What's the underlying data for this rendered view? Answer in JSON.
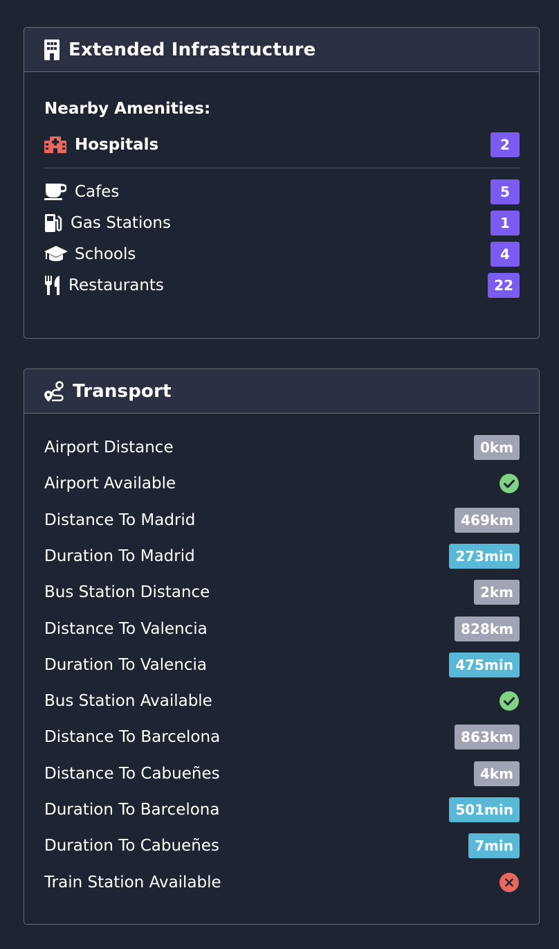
{
  "infrastructure": {
    "title": "Extended Infrastructure",
    "header_icon": "building-icon",
    "section_label": "Nearby Amenities:",
    "highlight": {
      "label": "Hospitals",
      "count": "2",
      "icon": "hospital-icon",
      "icon_color": "#e8685e"
    },
    "items": [
      {
        "label": "Cafes",
        "count": "5",
        "icon": "coffee-cup-icon"
      },
      {
        "label": "Gas Stations",
        "count": "1",
        "icon": "gas-pump-icon"
      },
      {
        "label": "Schools",
        "count": "4",
        "icon": "graduation-cap-icon"
      },
      {
        "label": "Restaurants",
        "count": "22",
        "icon": "utensils-icon"
      }
    ]
  },
  "transport": {
    "title": "Transport",
    "header_icon": "route-icon",
    "rows": [
      {
        "label": "Airport Distance",
        "value": "0km",
        "kind": "distance"
      },
      {
        "label": "Airport Available",
        "status": "yes",
        "icon": "check-circle-icon"
      },
      {
        "label": "Distance To Madrid",
        "value": "469km",
        "kind": "distance"
      },
      {
        "label": "Duration To Madrid",
        "value": "273min",
        "kind": "duration"
      },
      {
        "label": "Bus Station Distance",
        "value": "2km",
        "kind": "distance"
      },
      {
        "label": "Distance To Valencia",
        "value": "828km",
        "kind": "distance"
      },
      {
        "label": "Duration To Valencia",
        "value": "475min",
        "kind": "duration"
      },
      {
        "label": "Bus Station Available",
        "status": "yes",
        "icon": "check-circle-icon"
      },
      {
        "label": "Distance To Barcelona",
        "value": "863km",
        "kind": "distance"
      },
      {
        "label": "Distance To Cabueñes",
        "value": "4km",
        "kind": "distance"
      },
      {
        "label": "Duration To Barcelona",
        "value": "501min",
        "kind": "duration"
      },
      {
        "label": "Duration To Cabueñes",
        "value": "7min",
        "kind": "duration"
      },
      {
        "label": "Train Station Available",
        "status": "no",
        "icon": "x-circle-icon"
      }
    ]
  },
  "colors": {
    "background": "#1f2432",
    "header": "#2b3142",
    "count_badge": "#7b5cf0",
    "distance_badge": "#a0a4b4",
    "duration_badge": "#59b8d6",
    "yes": "#7fd383",
    "no": "#e8685e"
  }
}
